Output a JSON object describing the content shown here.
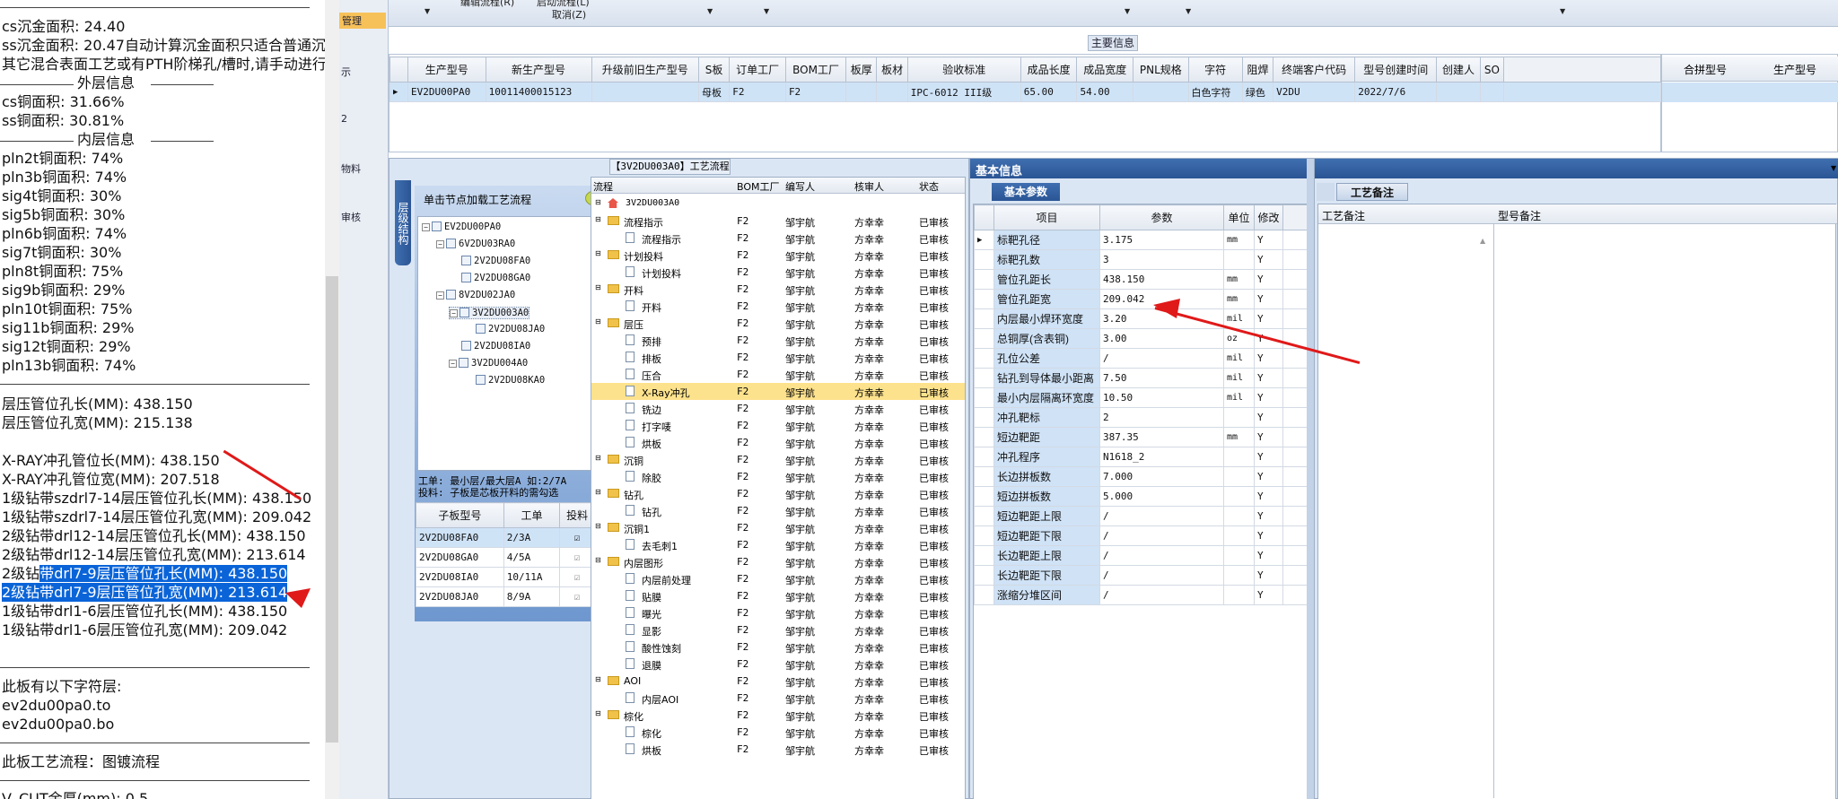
{
  "left_panel": {
    "lines": [
      "cs沉金面积: 24.40",
      "ss沉金面积: 20.47自动计算沉金面积只适合普通沉金",
      "其它混合表面工艺或有PTH阶梯孔/槽时,请手动进行",
      "外层信息",
      "cs铜面积: 31.66%",
      "ss铜面积: 30.81%",
      "内层信息",
      "pln2t铜面积: 74%",
      "pln3b铜面积: 74%",
      "sig4t铜面积: 30%",
      "sig5b铜面积: 30%",
      "pln6b铜面积: 74%",
      "sig7t铜面积: 30%",
      "pln8t铜面积: 75%",
      "sig9b铜面积: 29%",
      "pln10t铜面积: 75%",
      "sig11b铜面积: 29%",
      "sig12t铜面积: 29%",
      "pln13b铜面积: 74%",
      "层压管位孔长(MM): 438.150",
      "层压管位孔宽(MM): 215.138",
      "X-RAY冲孔管位长(MM): 438.150",
      "X-RAY冲孔管位宽(MM): 207.518",
      "1级钻带szdrl7-14层压管位孔长(MM): 438.150",
      "1级钻带szdrl7-14层压管位孔宽(MM): 209.042",
      "2级钻带drl12-14层压管位孔长(MM): 438.150",
      "2级钻带drl12-14层压管位孔宽(MM): 213.614",
      "2级钻",
      "带drl7-9层压管位孔长(MM): 438.150",
      "2级钻带drl7-9层压管位孔宽(MM): 213.614",
      "1级钻带drl1-6层压管位孔长(MM): 438.150",
      "1级钻带drl1-6层压管位孔宽(MM): 209.042",
      "此板有以下字符层:",
      "ev2du00pa0.to",
      "ev2du00pa0.bo",
      "此板工艺流程：图镀流程",
      "V_CUT余厚(mm): 0.5"
    ]
  },
  "nav": {
    "items": [
      "管理",
      "示",
      "2",
      "物料",
      "审核"
    ]
  },
  "toolbar": {
    "text1": "编辑流程(R)",
    "text2": "启动流程(L)",
    "text3": "取消(Z)"
  },
  "main_info": {
    "title": "主要信息",
    "columns": [
      "生产型号",
      "新生产型号",
      "升级前旧生产型号",
      "S板",
      "订单工厂",
      "BOM工厂",
      "板厚",
      "板材",
      "验收标准",
      "成品长度",
      "成品宽度",
      "PNL规格",
      "字符",
      "阻焊",
      "终端客户代码",
      "型号创建时间",
      "创建人",
      "SO"
    ],
    "row": [
      "EV2DU00PA0",
      "10011400015123",
      "",
      "母板",
      "F2",
      "F2",
      "",
      "",
      "IPC-6012 III级",
      "65.00",
      "54.00",
      "",
      "白色字符",
      "绿色",
      "V2DU",
      "2022/7/6",
      "",
      ""
    ],
    "right_columns": [
      "合拼型号",
      "生产型号"
    ]
  },
  "flow_panel": {
    "title": "【3V2DU003A0】工艺流程",
    "vertical_tab": "层级结构",
    "tree_hint": "单击节点加载工艺流程",
    "tree": [
      "EV2DU00PA0",
      "6V2DU03RA0",
      "2V2DU08FA0",
      "2V2DU08GA0",
      "8V2DU02JA0",
      "3V2DU003A0",
      "2V2DU08JA0",
      "2V2DU08IA0",
      "3V2DU004A0",
      "2V2DU08KA0"
    ],
    "note1": "工单: 最小层/最大层A 如:2/7A",
    "note2": "投料: 子板是芯板开料的需勾选",
    "sub_columns": [
      "子板型号",
      "工单",
      "投料"
    ],
    "sub_rows": [
      [
        "2V2DU08FA0",
        "2/3A"
      ],
      [
        "2V2DU08GA0",
        "4/5A"
      ],
      [
        "2V2DU08IA0",
        "10/11A"
      ],
      [
        "2V2DU08JA0",
        "8/9A"
      ]
    ],
    "flow_columns": [
      "流程",
      "BOM工厂",
      "编写人",
      "核审人",
      "状态"
    ],
    "flow_root": "3V2DU003A0",
    "flow_rows": [
      {
        "name": "流程指示",
        "folder": true
      },
      {
        "name": "流程指示",
        "folder": false
      },
      {
        "name": "计划投料",
        "folder": true
      },
      {
        "name": "计划投料",
        "folder": false
      },
      {
        "name": "开料",
        "folder": true
      },
      {
        "name": "开料",
        "folder": false
      },
      {
        "name": "层压",
        "folder": true
      },
      {
        "name": "预排",
        "folder": false
      },
      {
        "name": "排板",
        "folder": false
      },
      {
        "name": "压合",
        "folder": false
      },
      {
        "name": "X-Ray冲孔",
        "folder": false
      },
      {
        "name": "铣边",
        "folder": false
      },
      {
        "name": "打字唛",
        "folder": false
      },
      {
        "name": "烘板",
        "folder": false
      },
      {
        "name": "沉铜",
        "folder": true
      },
      {
        "name": "除胶",
        "folder": false
      },
      {
        "name": "钻孔",
        "folder": true
      },
      {
        "name": "钻孔",
        "folder": false
      },
      {
        "name": "沉铜1",
        "folder": true
      },
      {
        "name": "去毛刺1",
        "folder": false
      },
      {
        "name": "内层图形",
        "folder": true
      },
      {
        "name": "内层前处理",
        "folder": false
      },
      {
        "name": "贴膜",
        "folder": false
      },
      {
        "name": "曝光",
        "folder": false
      },
      {
        "name": "显影",
        "folder": false
      },
      {
        "name": "酸性蚀刻",
        "folder": false
      },
      {
        "name": "退膜",
        "folder": false
      },
      {
        "name": "AOI",
        "folder": true
      },
      {
        "name": "内层AOI",
        "folder": false
      },
      {
        "name": "棕化",
        "folder": true
      },
      {
        "name": "棕化",
        "folder": false
      },
      {
        "name": "烘板",
        "folder": false
      }
    ],
    "flow_common": {
      "bom": "F2",
      "author": "邹宇航",
      "reviewer": "方幸幸",
      "status": "已审核"
    }
  },
  "basic_info": {
    "title": "基本信息",
    "tab": "基本参数",
    "columns": [
      "项目",
      "参数",
      "单位",
      "修改"
    ],
    "rows": [
      [
        "标靶孔径",
        "3.175",
        "mm",
        "Y"
      ],
      [
        "标靶孔数",
        "3",
        "",
        "Y"
      ],
      [
        "管位孔距长",
        "438.150",
        "mm",
        "Y"
      ],
      [
        "管位孔距宽",
        "209.042",
        "mm",
        "Y"
      ],
      [
        "内层最小焊环宽度",
        "3.20",
        "mil",
        "Y"
      ],
      [
        "总铜厚(含表铜)",
        "3.00",
        "oz",
        "Y"
      ],
      [
        "孔位公差",
        "/",
        "mil",
        "Y"
      ],
      [
        "钻孔到导体最小距离",
        "7.50",
        "mil",
        "Y"
      ],
      [
        "最小内层隔离环宽度",
        "10.50",
        "mil",
        "Y"
      ],
      [
        "冲孔靶标",
        "2",
        "",
        "Y"
      ],
      [
        "短边靶距",
        "387.35",
        "mm",
        "Y"
      ],
      [
        "冲孔程序",
        "N1618_2",
        "",
        "Y"
      ],
      [
        "长边拼板数",
        "7.000",
        "",
        "Y"
      ],
      [
        "短边拼板数",
        "5.000",
        "",
        "Y"
      ],
      [
        "短边靶距上限",
        "/",
        "",
        "Y"
      ],
      [
        "短边靶距下限",
        "/",
        "",
        "Y"
      ],
      [
        "长边靶距上限",
        "/",
        "",
        "Y"
      ],
      [
        "长边靶距下限",
        "/",
        "",
        "Y"
      ],
      [
        "涨缩分堆区间",
        "/",
        "",
        "Y"
      ]
    ]
  },
  "process_notes": {
    "tab": "工艺备注",
    "col1": "工艺备注",
    "col2": "型号备注"
  },
  "colors": {
    "accent": "#2b5595",
    "arrow": "#e01919",
    "selection": "#0a64d8",
    "highlight_row": "#fde28d"
  }
}
